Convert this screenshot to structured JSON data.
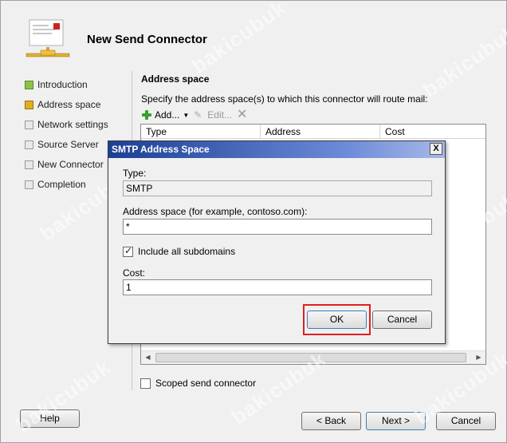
{
  "wizard": {
    "title": "New Send Connector"
  },
  "nav": {
    "items": [
      {
        "label": "Introduction",
        "state": "done"
      },
      {
        "label": "Address space",
        "state": "current"
      },
      {
        "label": "Network settings",
        "state": "pending"
      },
      {
        "label": "Source Server",
        "state": "pending"
      },
      {
        "label": "New Connector",
        "state": "pending"
      },
      {
        "label": "Completion",
        "state": "pending"
      }
    ]
  },
  "address_space": {
    "section_title": "Address space",
    "description": "Specify the address space(s) to which this connector will route mail:",
    "toolbar": {
      "add_label": "Add...",
      "edit_label": "Edit..."
    },
    "columns": [
      "Type",
      "Address",
      "Cost"
    ],
    "scoped_label": "Scoped send connector",
    "scoped_checked": false
  },
  "buttons": {
    "help": "Help",
    "back": "< Back",
    "next": "Next >",
    "cancel": "Cancel"
  },
  "dialog": {
    "title": "SMTP Address Space",
    "close_glyph": "X",
    "type_label": "Type:",
    "type_value": "SMTP",
    "address_label": "Address space (for example, contoso.com):",
    "address_value": "*",
    "subdomains_label": "Include all subdomains",
    "subdomains_checked": true,
    "cost_label": "Cost:",
    "cost_value": "1",
    "ok_label": "OK",
    "cancel_label": "Cancel"
  },
  "watermark": "bakicubuk",
  "colors": {
    "titlebar_start": "#1c3f94",
    "highlight": "#e02020",
    "add_icon": "#3aa030"
  }
}
